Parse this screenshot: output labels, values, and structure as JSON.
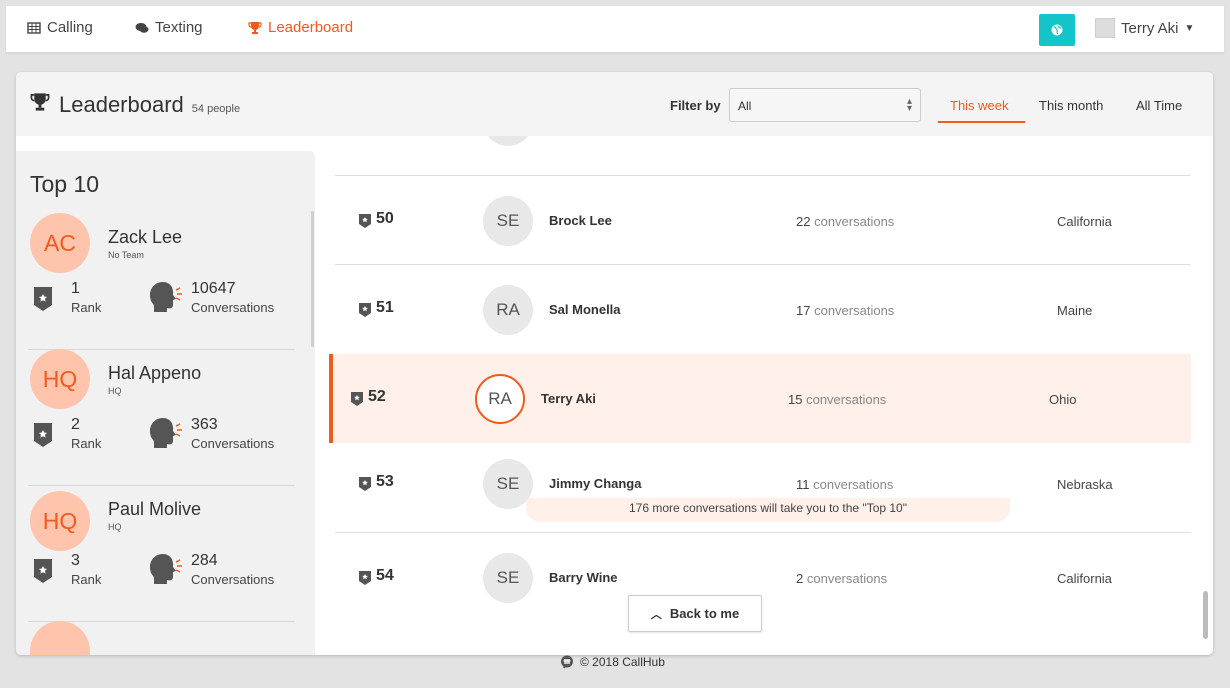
{
  "nav": {
    "items": [
      {
        "label": "Calling",
        "icon": "table-icon"
      },
      {
        "label": "Texting",
        "icon": "chat-icon"
      },
      {
        "label": "Leaderboard",
        "icon": "trophy-icon"
      }
    ],
    "user": {
      "name": "Terry Aki"
    }
  },
  "header": {
    "title": "Leaderboard",
    "people_count": "54 people",
    "filter_label": "Filter by",
    "filter_value": "All",
    "tabs": [
      {
        "label": "This week",
        "active": true
      },
      {
        "label": "This month",
        "active": false
      },
      {
        "label": "All Time",
        "active": false
      }
    ]
  },
  "top10": {
    "title": "Top 10",
    "rank_label": "Rank",
    "conv_label": "Conversations",
    "items": [
      {
        "initials": "AC",
        "name": "Zack Lee",
        "team": "No Team",
        "rank": "1",
        "conversations": "10647"
      },
      {
        "initials": "HQ",
        "name": "Hal Appeno",
        "team": "HQ",
        "rank": "2",
        "conversations": "363"
      },
      {
        "initials": "HQ",
        "name": "Paul Molive",
        "team": "HQ",
        "rank": "3",
        "conversations": "284"
      }
    ]
  },
  "list": {
    "conv_word": "conversations",
    "rows": [
      {
        "rank": "50",
        "initials": "SE",
        "name": "Brock Lee",
        "conversations": "22",
        "location": "California"
      },
      {
        "rank": "51",
        "initials": "RA",
        "name": "Sal Monella",
        "conversations": "17",
        "location": "Maine"
      },
      {
        "rank": "52",
        "initials": "RA",
        "name": "Terry Aki",
        "conversations": "15",
        "location": "Ohio"
      },
      {
        "rank": "53",
        "initials": "SE",
        "name": "Jimmy Changa",
        "conversations": "11",
        "location": "Nebraska"
      },
      {
        "rank": "54",
        "initials": "SE",
        "name": "Barry Wine",
        "conversations": "2",
        "location": "California"
      }
    ],
    "tip": "176 more conversations will take you to the \"Top 10\"",
    "back_label": "Back to me"
  },
  "footer": {
    "text": "© 2018 CallHub"
  },
  "colors": {
    "accent": "#ef5a1f",
    "teal": "#13c4c9",
    "avatar_bg": "#ffc4ab",
    "highlight": "#fff0ea"
  }
}
